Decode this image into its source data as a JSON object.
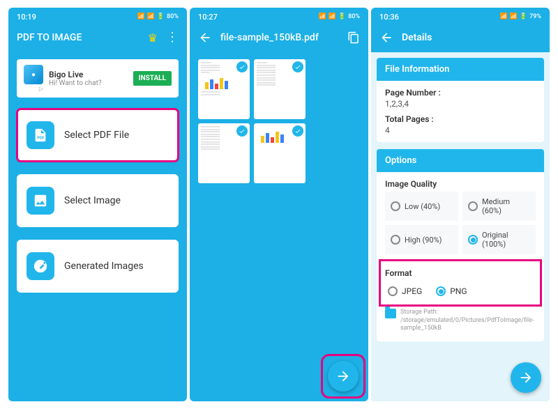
{
  "screen1": {
    "status_time": "10:19",
    "status_battery": "80%",
    "appbar_title": "PDF TO IMAGE",
    "ad": {
      "title": "Bigo Live",
      "subtitle": "Hi! Want to chat?",
      "button": "INSTALL"
    },
    "menu": {
      "select_pdf": "Select PDF File",
      "select_image": "Select Image",
      "generated": "Generated Images"
    }
  },
  "screen2": {
    "status_time": "10:27",
    "status_battery": "80%",
    "appbar_title": "file-sample_150kB.pdf"
  },
  "screen3": {
    "status_time": "10:36",
    "status_battery": "79%",
    "appbar_title": "Details",
    "file_info_header": "File Information",
    "page_number_label": "Page Number :",
    "page_number_value": "1,2,3,4",
    "total_pages_label": "Total Pages :",
    "total_pages_value": "4",
    "options_header": "Options",
    "image_quality_label": "Image Quality",
    "quality": {
      "low": "Low (40%)",
      "medium": "Medium (60%)",
      "high": "High (90%)",
      "original": "Original (100%)"
    },
    "format_label": "Format",
    "format": {
      "jpeg": "JPEG",
      "png": "PNG"
    },
    "storage_path": "Storage Path: /storage/emulated/0/Pictures/PdfToImage/file-sample_150kB"
  }
}
